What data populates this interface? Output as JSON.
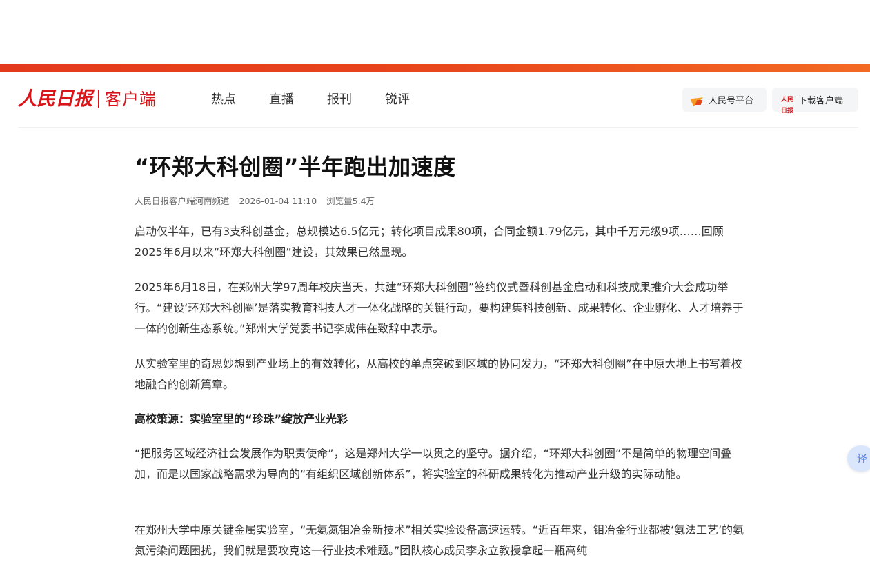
{
  "header": {
    "logo_main": "人民日报",
    "logo_sub": "客户端",
    "nav": [
      "热点",
      "直播",
      "报刊",
      "锐评"
    ],
    "platform_button": "人民号平台",
    "download_button": "下载客户端",
    "download_icon_text": "人民日报",
    "icons": {
      "platform": "megaphone-icon",
      "download": "app-logo-icon"
    }
  },
  "colors": {
    "brand_red": "#d8161a",
    "accent_orange": "#e8461d"
  },
  "article": {
    "title": "“环郑大科创圈”半年跑出加速度",
    "source": "人民日报客户端河南频道",
    "datetime": "2026-01-04 11:10",
    "views": "浏览量5.4万",
    "paragraphs": [
      "启动仅半年，已有3支科创基金，总规模达6.5亿元；转化项目成果80项，合同金额1.79亿元，其中千万元级9项……回顾2025年6月以来“环郑大科创圈”建设，其效果已然显现。",
      "2025年6月18日，在郑州大学97周年校庆当天，共建“环郑大科创圈”签约仪式暨科创基金启动和科技成果推介大会成功举行。“建设‘环郑大科创圈’是落实教育科技人才一体化战略的关键行动，要构建集科技创新、成果转化、企业孵化、人才培养于一体的创新生态系统。”郑州大学党委书记李成伟在致辞中表示。",
      "从实验室里的奇思妙想到产业场上的有效转化，从高校的单点突破到区域的协同发力，“环郑大科创圈”在中原大地上书写着校地融合的创新篇章。"
    ],
    "subheading": "高校策源：实验室里的“珍珠”绽放产业光彩",
    "paragraphs_2": [
      "“把服务区域经济社会发展作为职责使命”，这是郑州大学一以贯之的坚守。据介绍，“环郑大科创圈”不是简单的物理空间叠加，而是以国家战略需求为导向的“有组织区域创新体系”，将实验室的科研成果转化为推动产业升级的实际动能。",
      "在郑州大学中原关键金属实验室，“无氨氮钼冶金新技术”相关实验设备高速运转。“近百年来，钼冶金行业都被‘氨法工艺’的氨氮污染问题困扰，我们就是要攻克这一行业技术难题。”团队核心成员李永立教授拿起一瓶高纯"
    ]
  },
  "floating": {
    "translate_label": "译"
  }
}
